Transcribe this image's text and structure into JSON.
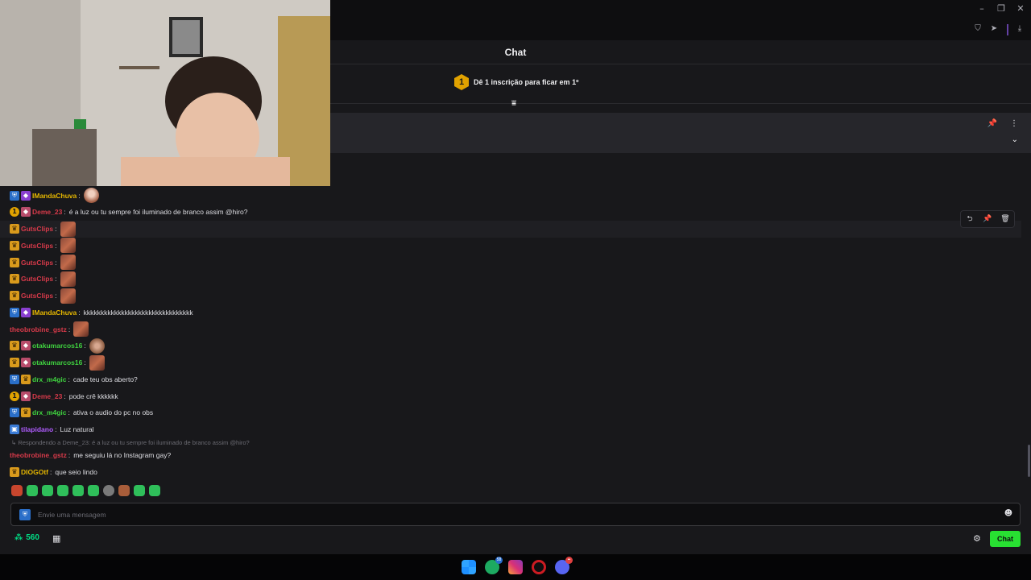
{
  "window": {
    "minimize_icon": "minimize-icon",
    "restore_icon": "restore-icon",
    "close_icon": "close-icon"
  },
  "toolbar": {
    "icons": [
      "shield-icon",
      "send-icon",
      "download-icon"
    ]
  },
  "chat_header": {
    "title": "Chat"
  },
  "sub_banner": {
    "rank": "1",
    "text": "Dê 1 inscrição para ficar em 1º"
  },
  "messages": [
    {
      "user": "IMandaChuva",
      "color": "#e6b700",
      "badges": [
        "prime",
        "purple"
      ],
      "text": "",
      "emote": "face"
    },
    {
      "user": "Deme_23",
      "color": "#d83a4a",
      "badges": [
        "gold",
        "red"
      ],
      "text": "é a luz ou tu sempre foi iluminado de branco assim @hiro?"
    },
    {
      "user": "GutsClips",
      "color": "#d83a4a",
      "badges": [
        "crown"
      ],
      "text": "",
      "emote": "square"
    },
    {
      "user": "GutsClips",
      "color": "#d83a4a",
      "badges": [
        "crown"
      ],
      "text": "",
      "emote": "square"
    },
    {
      "user": "GutsClips",
      "color": "#d83a4a",
      "badges": [
        "crown"
      ],
      "text": "",
      "emote": "square"
    },
    {
      "user": "GutsClips",
      "color": "#d83a4a",
      "badges": [
        "crown"
      ],
      "text": "",
      "emote": "square"
    },
    {
      "user": "GutsClips",
      "color": "#d83a4a",
      "badges": [
        "crown"
      ],
      "text": "",
      "emote": "square"
    },
    {
      "user": "IMandaChuva",
      "color": "#e6b700",
      "badges": [
        "prime",
        "purple"
      ],
      "text": "kkkkkkkkkkkkkkkkkkkkkkkkkkkkkkkk"
    },
    {
      "user": "theobrobine_gstz",
      "color": "#d83a4a",
      "badges": [],
      "text": "",
      "emote": "square"
    },
    {
      "user": "otakumarcos16",
      "color": "#3fd13f",
      "badges": [
        "crown",
        "red"
      ],
      "text": "",
      "emote": "round"
    },
    {
      "user": "otakumarcos16",
      "color": "#3fd13f",
      "badges": [
        "crown",
        "red"
      ],
      "text": "",
      "emote": "square"
    },
    {
      "user": "drx_m4gic",
      "color": "#3fd13f",
      "badges": [
        "prime",
        "crown"
      ],
      "text": "cade teu obs aberto?"
    },
    {
      "user": "Deme_23",
      "color": "#d83a4a",
      "badges": [
        "gold",
        "red"
      ],
      "text": "pode crê kkkkkk"
    },
    {
      "user": "drx_m4gic",
      "color": "#3fd13f",
      "badges": [
        "prime",
        "crown"
      ],
      "text": "ativa o audio do pc no obs"
    },
    {
      "user": "tilapidano",
      "color": "#b05cff",
      "badges": [
        "turbo"
      ],
      "text": "Luz natural"
    },
    {
      "user": "theobrobine_gstz",
      "color": "#d83a4a",
      "badges": [],
      "text": "me seguiu lá no Instagram gay?",
      "reply": "Respondendo a Deme_23: é a luz ou tu sempre foi iluminado de branco assim @hiro?"
    },
    {
      "user": "DIOGOtf",
      "color": "#e6b700",
      "badges": [
        "crown"
      ],
      "text": "que seio lindo"
    }
  ],
  "message_actions": [
    "reply-icon",
    "pin-icon",
    "delete-icon"
  ],
  "input": {
    "placeholder": "Envie uma mensagem"
  },
  "points": {
    "value": "560"
  },
  "chat_button": {
    "label": "Chat"
  },
  "taskbar": {
    "whatsapp_badge": "58",
    "discord_badge": "••"
  }
}
